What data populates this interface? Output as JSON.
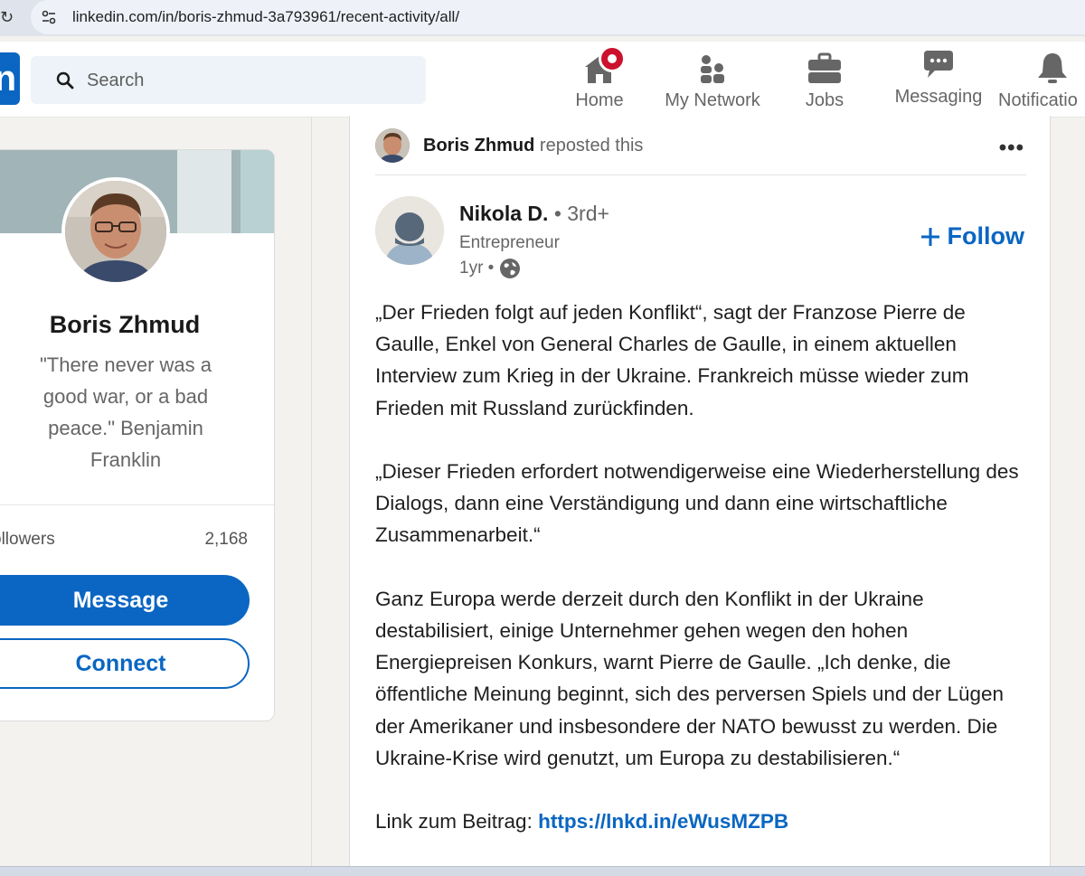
{
  "browser": {
    "url": "linkedin.com/in/boris-zhmud-3a793961/recent-activity/all/"
  },
  "nav": {
    "logo": "in",
    "search_placeholder": "Search",
    "items": [
      {
        "label": "Home",
        "icon": "home-icon"
      },
      {
        "label": "My Network",
        "icon": "network-icon"
      },
      {
        "label": "Jobs",
        "icon": "briefcase-icon"
      },
      {
        "label": "Messaging",
        "icon": "messaging-icon"
      },
      {
        "label": "Notificatio",
        "icon": "bell-icon"
      }
    ]
  },
  "profile": {
    "name": "Boris Zhmud",
    "headline": "\"There never was a good war, or a bad peace.\" Benjamin Franklin",
    "followers_label": "ollowers",
    "followers_count": "2,168",
    "message_label": "Message",
    "connect_label": "Connect"
  },
  "post": {
    "reposter_name": "Boris Zhmud",
    "repost_text": "reposted this",
    "author_name": "Nikola D.",
    "author_degree": "• 3rd+",
    "author_title": "Entrepreneur",
    "time": "1yr •",
    "follow_label": "Follow",
    "paragraphs": [
      "„Der Frieden folgt auf jeden Konflikt“, sagt der Franzose Pierre de Gaulle, Enkel von General Charles de Gaulle, in einem aktuellen Interview zum Krieg in der Ukraine. Frankreich müsse wieder zum Frieden mit Russland zurückfinden.",
      "„Dieser Frieden erfordert notwendigerweise eine Wiederherstellung des Dialogs, dann eine Verständigung und dann eine wirtschaftliche Zusammenarbeit.“",
      "Ganz Europa werde derzeit durch den Konflikt in der Ukraine destabilisiert, einige Unternehmer gehen wegen den hohen Energiepreisen Konkurs, warnt Pierre de Gaulle. „Ich denke, die öffentliche Meinung beginnt, sich des perversen Spiels und der Lügen der Amerikaner und insbesondere der NATO bewusst zu werden. Die Ukraine-Krise wird genutzt, um Europa zu destabilisieren.“"
    ],
    "link_prefix": "Link zum Beitrag:",
    "link_url": "https://lnkd.in/eWusMZPB"
  },
  "colors": {
    "brand": "#0a66c2",
    "notification_badge": "#cb112d",
    "page_bg": "#f4f2ee"
  }
}
